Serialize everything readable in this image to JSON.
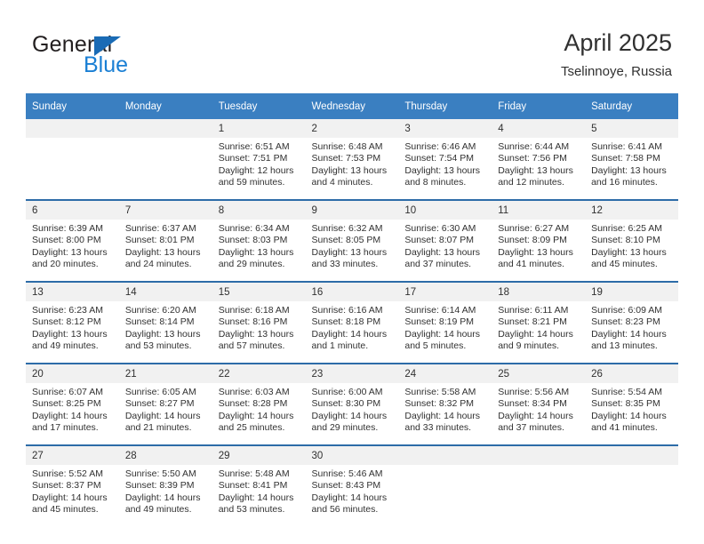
{
  "brand": {
    "line1": "General",
    "line2": "Blue",
    "triangle_icon": "brand-triangle-icon",
    "accent_color": "#1a7fd4"
  },
  "header": {
    "title": "April 2025",
    "subtitle": "Tselinnoye, Russia"
  },
  "calendar": {
    "header_bg": "#3a7fc1",
    "row_divider": "#2d6ca8",
    "daynum_bg": "#f1f1f1",
    "weekdays": [
      "Sunday",
      "Monday",
      "Tuesday",
      "Wednesday",
      "Thursday",
      "Friday",
      "Saturday"
    ],
    "weeks": [
      [
        {
          "day": "",
          "sunrise": "",
          "sunset": "",
          "daylight": ""
        },
        {
          "day": "",
          "sunrise": "",
          "sunset": "",
          "daylight": ""
        },
        {
          "day": "1",
          "sunrise": "Sunrise: 6:51 AM",
          "sunset": "Sunset: 7:51 PM",
          "daylight": "Daylight: 12 hours and 59 minutes."
        },
        {
          "day": "2",
          "sunrise": "Sunrise: 6:48 AM",
          "sunset": "Sunset: 7:53 PM",
          "daylight": "Daylight: 13 hours and 4 minutes."
        },
        {
          "day": "3",
          "sunrise": "Sunrise: 6:46 AM",
          "sunset": "Sunset: 7:54 PM",
          "daylight": "Daylight: 13 hours and 8 minutes."
        },
        {
          "day": "4",
          "sunrise": "Sunrise: 6:44 AM",
          "sunset": "Sunset: 7:56 PM",
          "daylight": "Daylight: 13 hours and 12 minutes."
        },
        {
          "day": "5",
          "sunrise": "Sunrise: 6:41 AM",
          "sunset": "Sunset: 7:58 PM",
          "daylight": "Daylight: 13 hours and 16 minutes."
        }
      ],
      [
        {
          "day": "6",
          "sunrise": "Sunrise: 6:39 AM",
          "sunset": "Sunset: 8:00 PM",
          "daylight": "Daylight: 13 hours and 20 minutes."
        },
        {
          "day": "7",
          "sunrise": "Sunrise: 6:37 AM",
          "sunset": "Sunset: 8:01 PM",
          "daylight": "Daylight: 13 hours and 24 minutes."
        },
        {
          "day": "8",
          "sunrise": "Sunrise: 6:34 AM",
          "sunset": "Sunset: 8:03 PM",
          "daylight": "Daylight: 13 hours and 29 minutes."
        },
        {
          "day": "9",
          "sunrise": "Sunrise: 6:32 AM",
          "sunset": "Sunset: 8:05 PM",
          "daylight": "Daylight: 13 hours and 33 minutes."
        },
        {
          "day": "10",
          "sunrise": "Sunrise: 6:30 AM",
          "sunset": "Sunset: 8:07 PM",
          "daylight": "Daylight: 13 hours and 37 minutes."
        },
        {
          "day": "11",
          "sunrise": "Sunrise: 6:27 AM",
          "sunset": "Sunset: 8:09 PM",
          "daylight": "Daylight: 13 hours and 41 minutes."
        },
        {
          "day": "12",
          "sunrise": "Sunrise: 6:25 AM",
          "sunset": "Sunset: 8:10 PM",
          "daylight": "Daylight: 13 hours and 45 minutes."
        }
      ],
      [
        {
          "day": "13",
          "sunrise": "Sunrise: 6:23 AM",
          "sunset": "Sunset: 8:12 PM",
          "daylight": "Daylight: 13 hours and 49 minutes."
        },
        {
          "day": "14",
          "sunrise": "Sunrise: 6:20 AM",
          "sunset": "Sunset: 8:14 PM",
          "daylight": "Daylight: 13 hours and 53 minutes."
        },
        {
          "day": "15",
          "sunrise": "Sunrise: 6:18 AM",
          "sunset": "Sunset: 8:16 PM",
          "daylight": "Daylight: 13 hours and 57 minutes."
        },
        {
          "day": "16",
          "sunrise": "Sunrise: 6:16 AM",
          "sunset": "Sunset: 8:18 PM",
          "daylight": "Daylight: 14 hours and 1 minute."
        },
        {
          "day": "17",
          "sunrise": "Sunrise: 6:14 AM",
          "sunset": "Sunset: 8:19 PM",
          "daylight": "Daylight: 14 hours and 5 minutes."
        },
        {
          "day": "18",
          "sunrise": "Sunrise: 6:11 AM",
          "sunset": "Sunset: 8:21 PM",
          "daylight": "Daylight: 14 hours and 9 minutes."
        },
        {
          "day": "19",
          "sunrise": "Sunrise: 6:09 AM",
          "sunset": "Sunset: 8:23 PM",
          "daylight": "Daylight: 14 hours and 13 minutes."
        }
      ],
      [
        {
          "day": "20",
          "sunrise": "Sunrise: 6:07 AM",
          "sunset": "Sunset: 8:25 PM",
          "daylight": "Daylight: 14 hours and 17 minutes."
        },
        {
          "day": "21",
          "sunrise": "Sunrise: 6:05 AM",
          "sunset": "Sunset: 8:27 PM",
          "daylight": "Daylight: 14 hours and 21 minutes."
        },
        {
          "day": "22",
          "sunrise": "Sunrise: 6:03 AM",
          "sunset": "Sunset: 8:28 PM",
          "daylight": "Daylight: 14 hours and 25 minutes."
        },
        {
          "day": "23",
          "sunrise": "Sunrise: 6:00 AM",
          "sunset": "Sunset: 8:30 PM",
          "daylight": "Daylight: 14 hours and 29 minutes."
        },
        {
          "day": "24",
          "sunrise": "Sunrise: 5:58 AM",
          "sunset": "Sunset: 8:32 PM",
          "daylight": "Daylight: 14 hours and 33 minutes."
        },
        {
          "day": "25",
          "sunrise": "Sunrise: 5:56 AM",
          "sunset": "Sunset: 8:34 PM",
          "daylight": "Daylight: 14 hours and 37 minutes."
        },
        {
          "day": "26",
          "sunrise": "Sunrise: 5:54 AM",
          "sunset": "Sunset: 8:35 PM",
          "daylight": "Daylight: 14 hours and 41 minutes."
        }
      ],
      [
        {
          "day": "27",
          "sunrise": "Sunrise: 5:52 AM",
          "sunset": "Sunset: 8:37 PM",
          "daylight": "Daylight: 14 hours and 45 minutes."
        },
        {
          "day": "28",
          "sunrise": "Sunrise: 5:50 AM",
          "sunset": "Sunset: 8:39 PM",
          "daylight": "Daylight: 14 hours and 49 minutes."
        },
        {
          "day": "29",
          "sunrise": "Sunrise: 5:48 AM",
          "sunset": "Sunset: 8:41 PM",
          "daylight": "Daylight: 14 hours and 53 minutes."
        },
        {
          "day": "30",
          "sunrise": "Sunrise: 5:46 AM",
          "sunset": "Sunset: 8:43 PM",
          "daylight": "Daylight: 14 hours and 56 minutes."
        },
        {
          "day": "",
          "sunrise": "",
          "sunset": "",
          "daylight": ""
        },
        {
          "day": "",
          "sunrise": "",
          "sunset": "",
          "daylight": ""
        },
        {
          "day": "",
          "sunrise": "",
          "sunset": "",
          "daylight": ""
        }
      ]
    ]
  }
}
